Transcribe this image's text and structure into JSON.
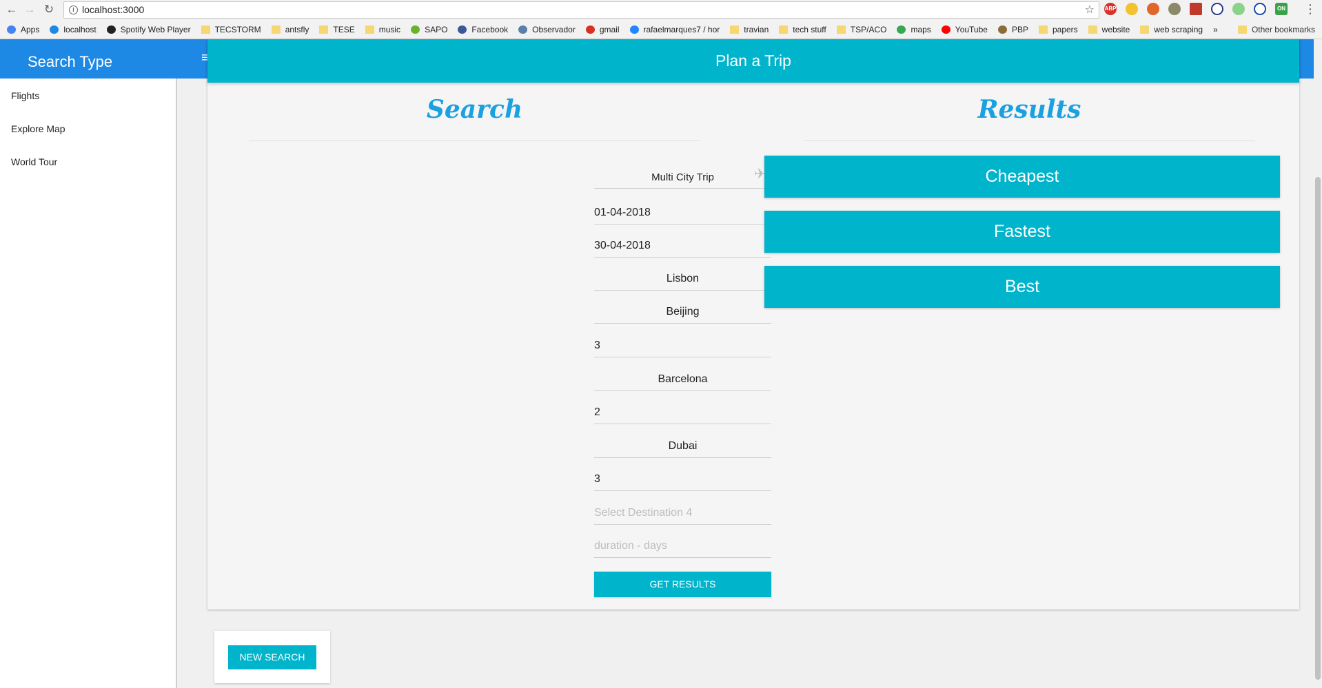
{
  "browser": {
    "url": "localhost:3000",
    "bookmarks": [
      {
        "label": "Apps",
        "icon": "apps-grid-icon",
        "color": "#4285f4"
      },
      {
        "label": "localhost",
        "icon": "r-icon",
        "color": "#1e88e5"
      },
      {
        "label": "Spotify Web Player",
        "icon": "spotify-icon",
        "color": "#222222"
      },
      {
        "label": "TECSTORM",
        "icon": "folder-icon",
        "color": "#f7d674"
      },
      {
        "label": "antsfly",
        "icon": "folder-icon",
        "color": "#f7d674"
      },
      {
        "label": "TESE",
        "icon": "folder-icon",
        "color": "#f7d674"
      },
      {
        "label": "music",
        "icon": "folder-icon",
        "color": "#f7d674"
      },
      {
        "label": "SAPO",
        "icon": "sapo-icon",
        "color": "#6ab42d"
      },
      {
        "label": "Facebook",
        "icon": "facebook-icon",
        "color": "#3b5998"
      },
      {
        "label": "Observador",
        "icon": "circle-icon",
        "color": "#5b7fa8"
      },
      {
        "label": "gmail",
        "icon": "gmail-icon",
        "color": "#d93025"
      },
      {
        "label": "rafaelmarques7 / hor",
        "icon": "bitbucket-icon",
        "color": "#2684ff"
      },
      {
        "label": "travian",
        "icon": "folder-icon",
        "color": "#f7d674"
      },
      {
        "label": "tech stuff",
        "icon": "folder-icon",
        "color": "#f7d674"
      },
      {
        "label": "TSP/ACO",
        "icon": "folder-icon",
        "color": "#f7d674"
      },
      {
        "label": "maps",
        "icon": "maps-icon",
        "color": "#34a853"
      },
      {
        "label": "YouTube",
        "icon": "youtube-icon",
        "color": "#ff0000"
      },
      {
        "label": "PBP",
        "icon": "pbp-icon",
        "color": "#8a6d3b"
      },
      {
        "label": "papers",
        "icon": "folder-icon",
        "color": "#f7d674"
      },
      {
        "label": "website",
        "icon": "folder-icon",
        "color": "#f7d674"
      },
      {
        "label": "web scraping",
        "icon": "folder-icon",
        "color": "#f7d674"
      }
    ],
    "more": "»",
    "other_bookmarks": "Other bookmarks"
  },
  "app": {
    "title": "Search Type",
    "menu_icon": "≡"
  },
  "sidebar": {
    "items": [
      {
        "label": "Flights"
      },
      {
        "label": "Explore Map"
      },
      {
        "label": "World Tour"
      }
    ]
  },
  "card": {
    "header": "Plan a Trip",
    "search_title": "Search",
    "results_title": "Results"
  },
  "form": {
    "trip_type": "Multi City Trip",
    "start_date": "01-04-2018",
    "end_date": "30-04-2018",
    "origin": "Lisbon",
    "dest1": "Beijing",
    "dur1": "3",
    "dest2": "Barcelona",
    "dur2": "2",
    "dest3": "Dubai",
    "dur3": "3",
    "dest4_placeholder": "Select Destination 4",
    "dur4_placeholder": "duration - days",
    "submit": "GET RESULTS"
  },
  "results": {
    "cheapest": "Cheapest",
    "fastest": "Fastest",
    "best": "Best"
  },
  "new_search": "NEW SEARCH",
  "colors": {
    "accent": "#00b4cc",
    "header_blue": "#1e88e5",
    "title_blue": "#1ba0e0"
  }
}
